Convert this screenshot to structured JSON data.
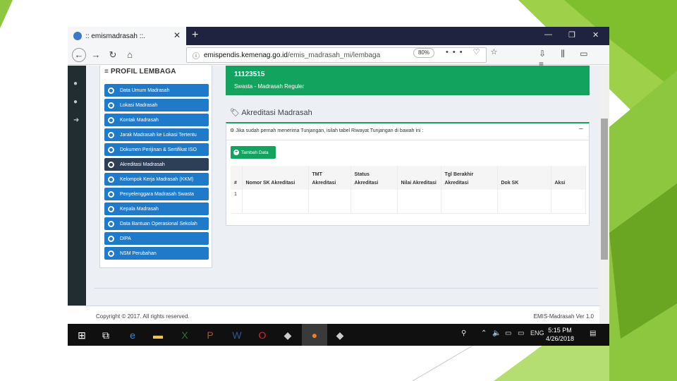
{
  "browser": {
    "tab_title": ":: emismadrasah ::.",
    "tab_close": "✕",
    "new_tab": "+",
    "window_controls": [
      "—",
      "❐",
      "✕"
    ],
    "url_host": "emispendis.kemenag.go.id",
    "url_path": "/emis_madrasah_mi/lembaga",
    "zoom": "80%",
    "url_icons": "••• ♡ ☆",
    "toolbar_icons": "⇩ ⫼ ▭ ≡"
  },
  "profil": {
    "title": "≡ PROFIL LEMBAGA",
    "menu": [
      {
        "label": "Data Umum Madrasah",
        "active": false
      },
      {
        "label": "Lokasi Madrasah",
        "active": false
      },
      {
        "label": "Kontak Madrasah",
        "active": false
      },
      {
        "label": "Jarak Madrasah ke Lokasi Tertentu",
        "active": false
      },
      {
        "label": "Dokumen Perijinan & Sertifikat ISO",
        "active": false
      },
      {
        "label": "Akreditasi Madrasah",
        "active": true
      },
      {
        "label": "Kelompok Kerja Madrasah (KKM)",
        "active": false
      },
      {
        "label": "Penyelenggara Madrasah Swasta",
        "active": false
      },
      {
        "label": "Kepala Madrasah",
        "active": false
      },
      {
        "label": "Data Bantuan Operasional Sekolah",
        "active": false
      },
      {
        "label": "DIPA",
        "active": false
      },
      {
        "label": "NSM Perubahan",
        "active": false
      }
    ]
  },
  "madrasah": {
    "nsm": "11123515",
    "status": "Swasta - Madrasah Reguler"
  },
  "akreditasi": {
    "heading": "Akreditasi Madrasah",
    "note": "Jika sudah pernah menerima Tunjangan, isilah tabel Riwayat Tunjangan di bawah ini :",
    "collapse": "−",
    "add_button": "Tambah Data",
    "columns": [
      "#",
      "Nomor SK Akreditasi",
      "TMT Akreditasi",
      "Status Akreditasi",
      "Nilai Akreditasi",
      "Tgl Berakhir Akreditasi",
      "Dok SK",
      "Aksi"
    ],
    "rows": [
      [
        "1",
        "",
        "",
        "",
        "",
        "",
        "",
        ""
      ]
    ]
  },
  "footer": {
    "copyright": "Copyright © 2017. All rights reserved.",
    "version": "EMIS-Madrasah Ver 1.0"
  },
  "taskbar": {
    "language": "ENG",
    "time": "5:15 PM",
    "date": "4/26/2018"
  },
  "colors": {
    "accent_green": "#12a45f",
    "menu_blue": "#1f7ac9",
    "menu_active": "#2d3e57",
    "slide_green": "#8dc63f"
  }
}
